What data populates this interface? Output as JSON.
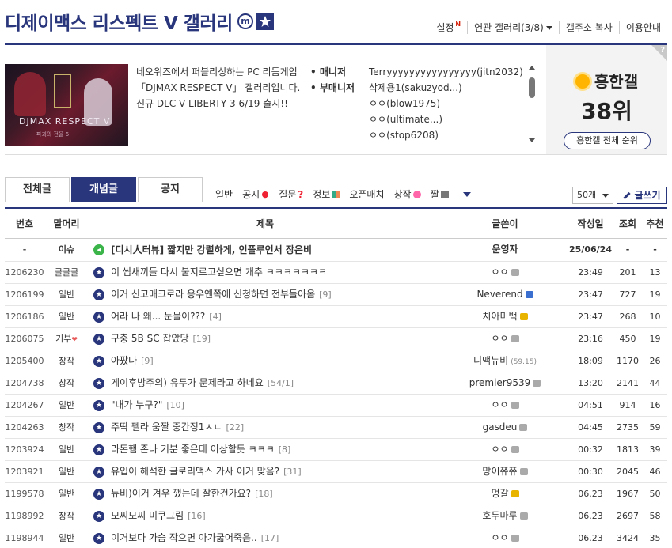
{
  "header": {
    "title": "디제이맥스 리스펙트 V 갤러리",
    "mini_badge": "m",
    "links": [
      {
        "label": "설정",
        "badge": "N"
      },
      {
        "label": "연관 갤러리(3/8)"
      },
      {
        "label": "갤주소 복사"
      },
      {
        "label": "이용안내"
      }
    ]
  },
  "info": {
    "thumb_title": "DJMAX RESPECT V",
    "thumb_sub": "파괴의 전율 6",
    "description": "네오위즈에서 퍼블리싱하는 PC 리듬게임 「DJMAX RESPECT V」 갤러리입니다. 신규 DLC V LIBERTY 3 6/19 출시!!",
    "manager_label": "매니저",
    "manager_value": "Terryyyyyyyyyyyyyyyy(jitn2032)",
    "submanager_label": "부매니저",
    "submanagers": [
      "삭제용1(sakuzyod...)",
      "ㅇㅇ(blow1975)",
      "ㅇㅇ(ultimate...)",
      "ㅇㅇ(stop6208)"
    ],
    "rank_label": "흥한갤",
    "rank_value": "38위",
    "rank_button": "흥한갤 전체 순위",
    "help_mark": "?"
  },
  "tabs": [
    {
      "label": "전체글"
    },
    {
      "label": "개념글"
    },
    {
      "label": "공지"
    }
  ],
  "categories": [
    {
      "label": "일반",
      "icon": ""
    },
    {
      "label": "공지",
      "icon": "pin-icon"
    },
    {
      "label": "질문",
      "icon": "question-icon"
    },
    {
      "label": "정보",
      "icon": "book-icon"
    },
    {
      "label": "오픈매치",
      "icon": ""
    },
    {
      "label": "창작",
      "icon": "flower-icon"
    },
    {
      "label": "짤",
      "icon": "board-icon"
    }
  ],
  "per_page": "50개",
  "write_button": "글쓰기",
  "table": {
    "headers": {
      "no": "번호",
      "head": "말머리",
      "title": "제목",
      "writer": "글쓴이",
      "date": "작성일",
      "views": "조회",
      "recs": "추천"
    },
    "rows": [
      {
        "no": "-",
        "head": "이슈",
        "title": "[디시人터뷰] 짧지만 강렬하게, 인플루언서 장은비",
        "comments": "",
        "writer": "운영자",
        "tag": "",
        "ip": "",
        "date": "25/06/24",
        "views": "-",
        "recs": "-",
        "issue": true
      },
      {
        "no": "1206230",
        "head": "글글글",
        "title": "이 씹새끼들 다시 불지르고싶으면 개추 ㅋㅋㅋㅋㅋㅋㅋ",
        "comments": "",
        "writer": "ㅇㅇ",
        "tag": "gray",
        "ip": "",
        "date": "23:49",
        "views": "201",
        "recs": "13"
      },
      {
        "no": "1206199",
        "head": "일반",
        "title": "이거 신고매크로라 응우옌쪽에 신청하면 전부들아옴",
        "comments": "[9]",
        "writer": "Neverend",
        "tag": "fixed",
        "ip": "",
        "date": "23:47",
        "views": "727",
        "recs": "19"
      },
      {
        "no": "1206186",
        "head": "일반",
        "title": "어라 나 왜... 눈물이???",
        "comments": "[4]",
        "writer": "치아미백",
        "tag": "lock",
        "ip": "",
        "date": "23:47",
        "views": "268",
        "recs": "10"
      },
      {
        "no": "1206075",
        "head": "기부",
        "title": "구충 5B SC 잡았당",
        "comments": "[19]",
        "writer": "ㅇㅇ",
        "tag": "gray",
        "ip": "",
        "date": "23:16",
        "views": "450",
        "recs": "19"
      },
      {
        "no": "1205400",
        "head": "창작",
        "title": "아팠다",
        "comments": "[9]",
        "writer": "디맥뉴비",
        "tag": "",
        "ip": "(59.15)",
        "date": "18:09",
        "views": "1170",
        "recs": "26"
      },
      {
        "no": "1204738",
        "head": "창작",
        "title": "게이후방주의) 유두가 문제라고 하네요",
        "comments": "[54/1]",
        "writer": "premier9539",
        "tag": "gray",
        "ip": "",
        "date": "13:20",
        "views": "2141",
        "recs": "44"
      },
      {
        "no": "1204267",
        "head": "일반",
        "title": "\"내가 누구?\"",
        "comments": "[10]",
        "writer": "ㅇㅇ",
        "tag": "gray",
        "ip": "",
        "date": "04:51",
        "views": "914",
        "recs": "16"
      },
      {
        "no": "1204263",
        "head": "창작",
        "title": "주딱 펠라 움짤 중간정1ㅅㄴ",
        "comments": "[22]",
        "writer": "gasdeu",
        "tag": "gray",
        "ip": "",
        "date": "04:45",
        "views": "2735",
        "recs": "59"
      },
      {
        "no": "1203924",
        "head": "일반",
        "title": "라돈햄 존나 기분 좋은데 이상할듯 ㅋㅋㅋ",
        "comments": "[8]",
        "writer": "ㅇㅇ",
        "tag": "gray",
        "ip": "",
        "date": "00:32",
        "views": "1813",
        "recs": "39"
      },
      {
        "no": "1203921",
        "head": "일반",
        "title": "유입이 해석한 글로리맥스 가사 이거 맞음?",
        "comments": "[31]",
        "writer": "망이쮸쮸",
        "tag": "gray",
        "ip": "",
        "date": "00:30",
        "views": "2045",
        "recs": "46"
      },
      {
        "no": "1199578",
        "head": "일반",
        "title": "뉴비)이거 겨우 깼는데 잘한건가요?",
        "comments": "[18]",
        "writer": "멍갈",
        "tag": "lock",
        "ip": "",
        "date": "06.23",
        "views": "1967",
        "recs": "50"
      },
      {
        "no": "1198992",
        "head": "창작",
        "title": "모찌모찌 미쿠그림",
        "comments": "[16]",
        "writer": "호두마루",
        "tag": "gray",
        "ip": "",
        "date": "06.23",
        "views": "2697",
        "recs": "58"
      },
      {
        "no": "1198944",
        "head": "일반",
        "title": "이거보다 가슴 작으면 아가굶어죽음..",
        "comments": "[17]",
        "writer": "ㅇㅇ",
        "tag": "gray",
        "ip": "",
        "date": "06.23",
        "views": "3424",
        "recs": "35"
      }
    ]
  },
  "colors": {
    "brand": "#29367c",
    "accent_red": "#d31900"
  }
}
